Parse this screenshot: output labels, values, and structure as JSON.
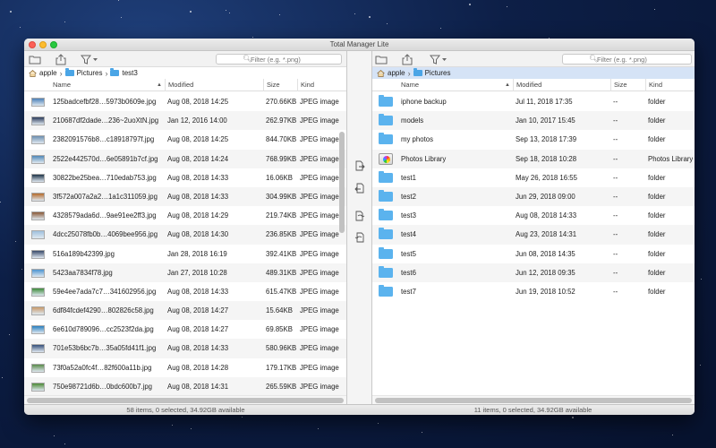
{
  "window": {
    "title": "Total Manager Lite"
  },
  "filter_placeholder": "Filter (e.g. *.png)",
  "columns": {
    "name": "Name",
    "modified": "Modified",
    "size": "Size",
    "kind": "Kind"
  },
  "left_pane": {
    "breadcrumb": [
      "apple",
      "Pictures",
      "test3"
    ],
    "status": "58 items, 0 selected, 34.92GB available",
    "rows": [
      {
        "name": "125badcefbf28…5973b0609e.jpg",
        "modified": "Aug 08, 2018 14:25",
        "size": "270.66KB",
        "kind": "JPEG image",
        "thumb": "#4a7fb8"
      },
      {
        "name": "210687df2dade…236~2uoXtN.jpg",
        "modified": "Jan 12, 2016 14:00",
        "size": "262.97KB",
        "kind": "JPEG image",
        "thumb": "#2b3a5a"
      },
      {
        "name": "2382091576b8…c18918797f.jpg",
        "modified": "Aug 08, 2018 14:25",
        "size": "844.70KB",
        "kind": "JPEG image",
        "thumb": "#6d8fb0"
      },
      {
        "name": "2522e442570d…6e05891b7cf.jpg",
        "modified": "Aug 08, 2018 14:24",
        "size": "768.99KB",
        "kind": "JPEG image",
        "thumb": "#4f87b7"
      },
      {
        "name": "30822be25bea…710edab753.jpg",
        "modified": "Aug 08, 2018 14:33",
        "size": "16.06KB",
        "kind": "JPEG image",
        "thumb": "#1e3448"
      },
      {
        "name": "3f572a007a2a2…1a1c311059.jpg",
        "modified": "Aug 08, 2018 14:33",
        "size": "304.99KB",
        "kind": "JPEG image",
        "thumb": "#b56a2a"
      },
      {
        "name": "4328579ada6d…9ae91ee2ff3.jpg",
        "modified": "Aug 08, 2018 14:29",
        "size": "219.74KB",
        "kind": "JPEG image",
        "thumb": "#8a5a38"
      },
      {
        "name": "4dcc25078fb0b…4069bee956.jpg",
        "modified": "Aug 08, 2018 14:30",
        "size": "236.85KB",
        "kind": "JPEG image",
        "thumb": "#9fc0de"
      },
      {
        "name": "516a189b42399.jpg",
        "modified": "Jan 28, 2018 16:19",
        "size": "392.41KB",
        "kind": "JPEG image",
        "thumb": "#3a4a6a"
      },
      {
        "name": "5423aa7834f78.jpg",
        "modified": "Jan 27, 2018 10:28",
        "size": "489.31KB",
        "kind": "JPEG image",
        "thumb": "#4d94d0"
      },
      {
        "name": "59e4ee7ada7c7…341602956.jpg",
        "modified": "Aug 08, 2018 14:33",
        "size": "615.47KB",
        "kind": "JPEG image",
        "thumb": "#3d8a3a"
      },
      {
        "name": "6df84fcdef4290…802826c58.jpg",
        "modified": "Aug 08, 2018 14:27",
        "size": "15.64KB",
        "kind": "JPEG image",
        "thumb": "#c89a6a"
      },
      {
        "name": "6e610d789096…cc2523f2da.jpg",
        "modified": "Aug 08, 2018 14:27",
        "size": "69.85KB",
        "kind": "JPEG image",
        "thumb": "#2a7fbf"
      },
      {
        "name": "701e53b6bc7b…35a05fd41f1.jpg",
        "modified": "Aug 08, 2018 14:33",
        "size": "580.96KB",
        "kind": "JPEG image",
        "thumb": "#35507a"
      },
      {
        "name": "73f0a52a0fc4f…82f600a11b.jpg",
        "modified": "Aug 08, 2018 14:28",
        "size": "179.17KB",
        "kind": "JPEG image",
        "thumb": "#5a8a4a"
      },
      {
        "name": "750e98721d6b…0bdc600b7.jpg",
        "modified": "Aug 08, 2018 14:31",
        "size": "265.59KB",
        "kind": "JPEG image",
        "thumb": "#4c8a36"
      }
    ]
  },
  "right_pane": {
    "breadcrumb": [
      "apple",
      "Pictures"
    ],
    "status": "11 items, 0 selected, 34.92GB available",
    "rows": [
      {
        "name": "iphone backup",
        "modified": "Jul 11, 2018 17:35",
        "size": "--",
        "kind": "folder",
        "icon": "folder"
      },
      {
        "name": "models",
        "modified": "Jan 10, 2017 15:45",
        "size": "--",
        "kind": "folder",
        "icon": "folder"
      },
      {
        "name": "my photos",
        "modified": "Sep 13, 2018 17:39",
        "size": "--",
        "kind": "folder",
        "icon": "folder"
      },
      {
        "name": "Photos Library",
        "modified": "Sep 18, 2018 10:28",
        "size": "--",
        "kind": "Photos Library",
        "icon": "photos"
      },
      {
        "name": "test1",
        "modified": "May 26, 2018 16:55",
        "size": "--",
        "kind": "folder",
        "icon": "folder"
      },
      {
        "name": "test2",
        "modified": "Jun 29, 2018 09:00",
        "size": "--",
        "kind": "folder",
        "icon": "folder"
      },
      {
        "name": "test3",
        "modified": "Aug 08, 2018 14:33",
        "size": "--",
        "kind": "folder",
        "icon": "folder"
      },
      {
        "name": "test4",
        "modified": "Aug 23, 2018 14:31",
        "size": "--",
        "kind": "folder",
        "icon": "folder"
      },
      {
        "name": "test5",
        "modified": "Jun 08, 2018 14:35",
        "size": "--",
        "kind": "folder",
        "icon": "folder"
      },
      {
        "name": "test6",
        "modified": "Jun 12, 2018 09:35",
        "size": "--",
        "kind": "folder",
        "icon": "folder"
      },
      {
        "name": "test7",
        "modified": "Jun 19, 2018 10:52",
        "size": "--",
        "kind": "folder",
        "icon": "folder"
      }
    ]
  }
}
